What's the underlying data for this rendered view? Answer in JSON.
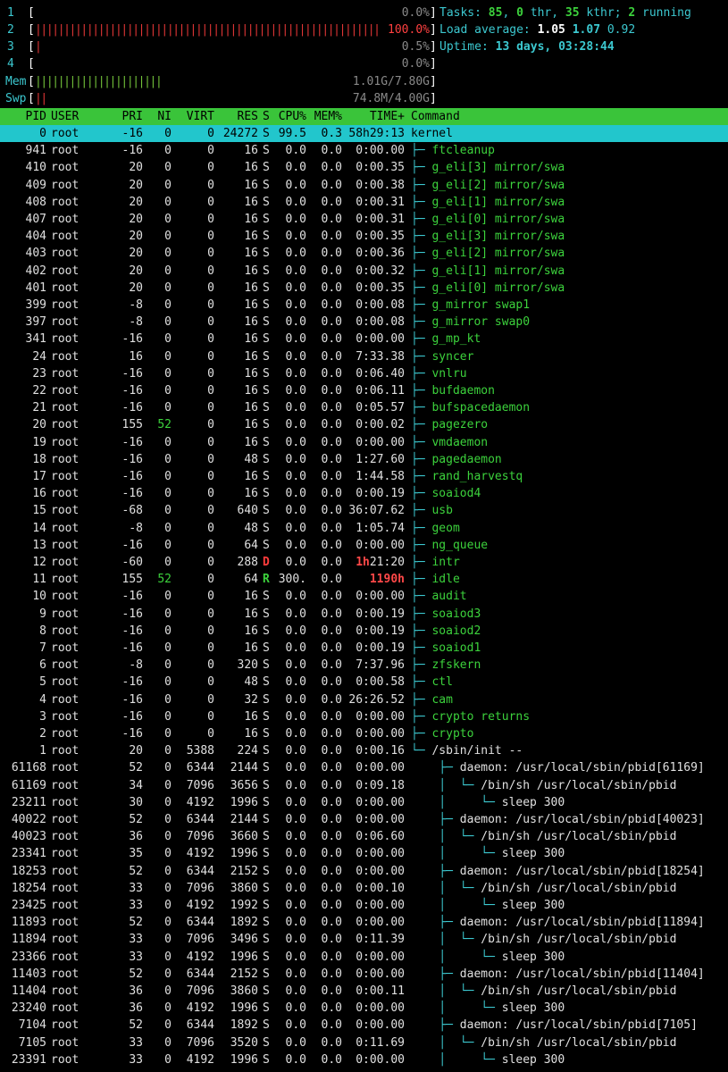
{
  "meters": {
    "cpu": [
      {
        "label": "1",
        "bar": "",
        "percent": "0.0%"
      },
      {
        "label": "2",
        "bar": "||||||||||||||||||||||||||||||||||||||||||||||||||||||||||||||||",
        "percent": "100.0%"
      },
      {
        "label": "3",
        "bar": "|",
        "percent": "0.5%"
      },
      {
        "label": "4",
        "bar": "",
        "percent": "0.0%"
      }
    ],
    "mem": {
      "label": "Mem",
      "bar": "||||||||||||||||||||||",
      "value": "1.01G/7.80G"
    },
    "swp": {
      "label": "Swp",
      "bar": "||",
      "value": "74.8M/4.00G"
    }
  },
  "summary": {
    "tasks_label": "Tasks: ",
    "tasks": "85",
    "thr": "0",
    "thr_label": " thr, ",
    "kthr": "35",
    "kthr_label": " kthr; ",
    "running": "2",
    "running_label": " running",
    "load_label": "Load average: ",
    "load1": "1.05",
    "load5": "1.07",
    "load15": "0.92",
    "uptime_label": "Uptime: ",
    "uptime": "13 days, 03:28:44"
  },
  "columns": [
    "PID",
    "USER",
    "PRI",
    "NI",
    "VIRT",
    "RES",
    "S",
    "CPU%",
    "MEM%",
    "TIME+",
    "Command"
  ],
  "processes": [
    {
      "pid": "0",
      "user": "root",
      "pri": "-16",
      "ni": "0",
      "virt": "0",
      "res": "24272",
      "s": "S",
      "cpu": "99.5",
      "mem": "0.3",
      "time": "58h29:13",
      "tree": "",
      "cmd": "kernel",
      "type": "sel"
    },
    {
      "pid": "941",
      "user": "root",
      "pri": "-16",
      "ni": "0",
      "virt": "0",
      "res": "16",
      "s": "S",
      "cpu": "0.0",
      "mem": "0.0",
      "time": "0:00.00",
      "tree": "├─ ",
      "cmd": "ftcleanup",
      "type": "k"
    },
    {
      "pid": "410",
      "user": "root",
      "pri": "20",
      "ni": "0",
      "virt": "0",
      "res": "16",
      "s": "S",
      "cpu": "0.0",
      "mem": "0.0",
      "time": "0:00.35",
      "tree": "├─ ",
      "cmd": "g_eli[3] mirror/swa",
      "type": "k"
    },
    {
      "pid": "409",
      "user": "root",
      "pri": "20",
      "ni": "0",
      "virt": "0",
      "res": "16",
      "s": "S",
      "cpu": "0.0",
      "mem": "0.0",
      "time": "0:00.38",
      "tree": "├─ ",
      "cmd": "g_eli[2] mirror/swa",
      "type": "k"
    },
    {
      "pid": "408",
      "user": "root",
      "pri": "20",
      "ni": "0",
      "virt": "0",
      "res": "16",
      "s": "S",
      "cpu": "0.0",
      "mem": "0.0",
      "time": "0:00.31",
      "tree": "├─ ",
      "cmd": "g_eli[1] mirror/swa",
      "type": "k"
    },
    {
      "pid": "407",
      "user": "root",
      "pri": "20",
      "ni": "0",
      "virt": "0",
      "res": "16",
      "s": "S",
      "cpu": "0.0",
      "mem": "0.0",
      "time": "0:00.31",
      "tree": "├─ ",
      "cmd": "g_eli[0] mirror/swa",
      "type": "k"
    },
    {
      "pid": "404",
      "user": "root",
      "pri": "20",
      "ni": "0",
      "virt": "0",
      "res": "16",
      "s": "S",
      "cpu": "0.0",
      "mem": "0.0",
      "time": "0:00.35",
      "tree": "├─ ",
      "cmd": "g_eli[3] mirror/swa",
      "type": "k"
    },
    {
      "pid": "403",
      "user": "root",
      "pri": "20",
      "ni": "0",
      "virt": "0",
      "res": "16",
      "s": "S",
      "cpu": "0.0",
      "mem": "0.0",
      "time": "0:00.36",
      "tree": "├─ ",
      "cmd": "g_eli[2] mirror/swa",
      "type": "k"
    },
    {
      "pid": "402",
      "user": "root",
      "pri": "20",
      "ni": "0",
      "virt": "0",
      "res": "16",
      "s": "S",
      "cpu": "0.0",
      "mem": "0.0",
      "time": "0:00.32",
      "tree": "├─ ",
      "cmd": "g_eli[1] mirror/swa",
      "type": "k"
    },
    {
      "pid": "401",
      "user": "root",
      "pri": "20",
      "ni": "0",
      "virt": "0",
      "res": "16",
      "s": "S",
      "cpu": "0.0",
      "mem": "0.0",
      "time": "0:00.35",
      "tree": "├─ ",
      "cmd": "g_eli[0] mirror/swa",
      "type": "k"
    },
    {
      "pid": "399",
      "user": "root",
      "pri": "-8",
      "ni": "0",
      "virt": "0",
      "res": "16",
      "s": "S",
      "cpu": "0.0",
      "mem": "0.0",
      "time": "0:00.08",
      "tree": "├─ ",
      "cmd": "g_mirror swap1",
      "type": "k"
    },
    {
      "pid": "397",
      "user": "root",
      "pri": "-8",
      "ni": "0",
      "virt": "0",
      "res": "16",
      "s": "S",
      "cpu": "0.0",
      "mem": "0.0",
      "time": "0:00.08",
      "tree": "├─ ",
      "cmd": "g_mirror swap0",
      "type": "k"
    },
    {
      "pid": "341",
      "user": "root",
      "pri": "-16",
      "ni": "0",
      "virt": "0",
      "res": "16",
      "s": "S",
      "cpu": "0.0",
      "mem": "0.0",
      "time": "0:00.00",
      "tree": "├─ ",
      "cmd": "g_mp_kt",
      "type": "k"
    },
    {
      "pid": "24",
      "user": "root",
      "pri": "16",
      "ni": "0",
      "virt": "0",
      "res": "16",
      "s": "S",
      "cpu": "0.0",
      "mem": "0.0",
      "time": "7:33.38",
      "tree": "├─ ",
      "cmd": "syncer",
      "type": "k"
    },
    {
      "pid": "23",
      "user": "root",
      "pri": "-16",
      "ni": "0",
      "virt": "0",
      "res": "16",
      "s": "S",
      "cpu": "0.0",
      "mem": "0.0",
      "time": "0:06.40",
      "tree": "├─ ",
      "cmd": "vnlru",
      "type": "k"
    },
    {
      "pid": "22",
      "user": "root",
      "pri": "-16",
      "ni": "0",
      "virt": "0",
      "res": "16",
      "s": "S",
      "cpu": "0.0",
      "mem": "0.0",
      "time": "0:06.11",
      "tree": "├─ ",
      "cmd": "bufdaemon",
      "type": "k"
    },
    {
      "pid": "21",
      "user": "root",
      "pri": "-16",
      "ni": "0",
      "virt": "0",
      "res": "16",
      "s": "S",
      "cpu": "0.0",
      "mem": "0.0",
      "time": "0:05.57",
      "tree": "├─ ",
      "cmd": "bufspacedaemon",
      "type": "k"
    },
    {
      "pid": "20",
      "user": "root",
      "pri": "155",
      "ni": "52",
      "virt": "0",
      "res": "16",
      "s": "S",
      "cpu": "0.0",
      "mem": "0.0",
      "time": "0:00.02",
      "tree": "├─ ",
      "cmd": "pagezero",
      "type": "k",
      "ni_green": true
    },
    {
      "pid": "19",
      "user": "root",
      "pri": "-16",
      "ni": "0",
      "virt": "0",
      "res": "16",
      "s": "S",
      "cpu": "0.0",
      "mem": "0.0",
      "time": "0:00.00",
      "tree": "├─ ",
      "cmd": "vmdaemon",
      "type": "k"
    },
    {
      "pid": "18",
      "user": "root",
      "pri": "-16",
      "ni": "0",
      "virt": "0",
      "res": "48",
      "s": "S",
      "cpu": "0.0",
      "mem": "0.0",
      "time": "1:27.60",
      "tree": "├─ ",
      "cmd": "pagedaemon",
      "type": "k"
    },
    {
      "pid": "17",
      "user": "root",
      "pri": "-16",
      "ni": "0",
      "virt": "0",
      "res": "16",
      "s": "S",
      "cpu": "0.0",
      "mem": "0.0",
      "time": "1:44.58",
      "tree": "├─ ",
      "cmd": "rand_harvestq",
      "type": "k"
    },
    {
      "pid": "16",
      "user": "root",
      "pri": "-16",
      "ni": "0",
      "virt": "0",
      "res": "16",
      "s": "S",
      "cpu": "0.0",
      "mem": "0.0",
      "time": "0:00.19",
      "tree": "├─ ",
      "cmd": "soaiod4",
      "type": "k"
    },
    {
      "pid": "15",
      "user": "root",
      "pri": "-68",
      "ni": "0",
      "virt": "0",
      "res": "640",
      "s": "S",
      "cpu": "0.0",
      "mem": "0.0",
      "time": "36:07.62",
      "tree": "├─ ",
      "cmd": "usb",
      "type": "k"
    },
    {
      "pid": "14",
      "user": "root",
      "pri": "-8",
      "ni": "0",
      "virt": "0",
      "res": "48",
      "s": "S",
      "cpu": "0.0",
      "mem": "0.0",
      "time": "1:05.74",
      "tree": "├─ ",
      "cmd": "geom",
      "type": "k"
    },
    {
      "pid": "13",
      "user": "root",
      "pri": "-16",
      "ni": "0",
      "virt": "0",
      "res": "64",
      "s": "S",
      "cpu": "0.0",
      "mem": "0.0",
      "time": "0:00.00",
      "tree": "├─ ",
      "cmd": "ng_queue",
      "type": "k"
    },
    {
      "pid": "12",
      "user": "root",
      "pri": "-60",
      "ni": "0",
      "virt": "0",
      "res": "288",
      "s": "D",
      "cpu": "0.0",
      "mem": "0.0",
      "time": "1h21:20",
      "time_hi": "1h",
      "time_rest": "21:20",
      "tree": "├─ ",
      "cmd": "intr",
      "type": "k"
    },
    {
      "pid": "11",
      "user": "root",
      "pri": "155",
      "ni": "52",
      "virt": "0",
      "res": "64",
      "s": "R",
      "cpu": "300.",
      "mem": "0.0",
      "time": "1190h",
      "time_hi": "1190h",
      "time_rest": "",
      "tree": "├─ ",
      "cmd": "idle",
      "type": "k",
      "ni_green": true
    },
    {
      "pid": "10",
      "user": "root",
      "pri": "-16",
      "ni": "0",
      "virt": "0",
      "res": "16",
      "s": "S",
      "cpu": "0.0",
      "mem": "0.0",
      "time": "0:00.00",
      "tree": "├─ ",
      "cmd": "audit",
      "type": "k"
    },
    {
      "pid": "9",
      "user": "root",
      "pri": "-16",
      "ni": "0",
      "virt": "0",
      "res": "16",
      "s": "S",
      "cpu": "0.0",
      "mem": "0.0",
      "time": "0:00.19",
      "tree": "├─ ",
      "cmd": "soaiod3",
      "type": "k"
    },
    {
      "pid": "8",
      "user": "root",
      "pri": "-16",
      "ni": "0",
      "virt": "0",
      "res": "16",
      "s": "S",
      "cpu": "0.0",
      "mem": "0.0",
      "time": "0:00.19",
      "tree": "├─ ",
      "cmd": "soaiod2",
      "type": "k"
    },
    {
      "pid": "7",
      "user": "root",
      "pri": "-16",
      "ni": "0",
      "virt": "0",
      "res": "16",
      "s": "S",
      "cpu": "0.0",
      "mem": "0.0",
      "time": "0:00.19",
      "tree": "├─ ",
      "cmd": "soaiod1",
      "type": "k"
    },
    {
      "pid": "6",
      "user": "root",
      "pri": "-8",
      "ni": "0",
      "virt": "0",
      "res": "320",
      "s": "S",
      "cpu": "0.0",
      "mem": "0.0",
      "time": "7:37.96",
      "tree": "├─ ",
      "cmd": "zfskern",
      "type": "k"
    },
    {
      "pid": "5",
      "user": "root",
      "pri": "-16",
      "ni": "0",
      "virt": "0",
      "res": "48",
      "s": "S",
      "cpu": "0.0",
      "mem": "0.0",
      "time": "0:00.58",
      "tree": "├─ ",
      "cmd": "ctl",
      "type": "k"
    },
    {
      "pid": "4",
      "user": "root",
      "pri": "-16",
      "ni": "0",
      "virt": "0",
      "res": "32",
      "s": "S",
      "cpu": "0.0",
      "mem": "0.0",
      "time": "26:26.52",
      "tree": "├─ ",
      "cmd": "cam",
      "type": "k"
    },
    {
      "pid": "3",
      "user": "root",
      "pri": "-16",
      "ni": "0",
      "virt": "0",
      "res": "16",
      "s": "S",
      "cpu": "0.0",
      "mem": "0.0",
      "time": "0:00.00",
      "tree": "├─ ",
      "cmd": "crypto returns",
      "type": "k"
    },
    {
      "pid": "2",
      "user": "root",
      "pri": "-16",
      "ni": "0",
      "virt": "0",
      "res": "16",
      "s": "S",
      "cpu": "0.0",
      "mem": "0.0",
      "time": "0:00.00",
      "tree": "├─ ",
      "cmd": "crypto",
      "type": "k"
    },
    {
      "pid": "1",
      "user": "root",
      "pri": "20",
      "ni": "0",
      "virt": "5388",
      "res": "224",
      "s": "S",
      "cpu": "0.0",
      "mem": "0.0",
      "time": "0:00.16",
      "tree": "└─ ",
      "cmd": "/sbin/init --",
      "type": "u"
    },
    {
      "pid": "61168",
      "user": "root",
      "pri": "52",
      "ni": "0",
      "virt": "6344",
      "res": "2144",
      "s": "S",
      "cpu": "0.0",
      "mem": "0.0",
      "time": "0:00.00",
      "tree": "    ├─ ",
      "cmd": "daemon: /usr/local/sbin/pbid[61169]",
      "type": "u"
    },
    {
      "pid": "61169",
      "user": "root",
      "pri": "34",
      "ni": "0",
      "virt": "7096",
      "res": "3656",
      "s": "S",
      "cpu": "0.0",
      "mem": "0.0",
      "time": "0:09.18",
      "tree": "    │  └─ ",
      "cmd": "/bin/sh /usr/local/sbin/pbid",
      "type": "u"
    },
    {
      "pid": "23211",
      "user": "root",
      "pri": "30",
      "ni": "0",
      "virt": "4192",
      "res": "1996",
      "s": "S",
      "cpu": "0.0",
      "mem": "0.0",
      "time": "0:00.00",
      "tree": "    │     └─ ",
      "cmd": "sleep 300",
      "type": "u"
    },
    {
      "pid": "40022",
      "user": "root",
      "pri": "52",
      "ni": "0",
      "virt": "6344",
      "res": "2144",
      "s": "S",
      "cpu": "0.0",
      "mem": "0.0",
      "time": "0:00.00",
      "tree": "    ├─ ",
      "cmd": "daemon: /usr/local/sbin/pbid[40023]",
      "type": "u"
    },
    {
      "pid": "40023",
      "user": "root",
      "pri": "36",
      "ni": "0",
      "virt": "7096",
      "res": "3660",
      "s": "S",
      "cpu": "0.0",
      "mem": "0.0",
      "time": "0:06.60",
      "tree": "    │  └─ ",
      "cmd": "/bin/sh /usr/local/sbin/pbid",
      "type": "u"
    },
    {
      "pid": "23341",
      "user": "root",
      "pri": "35",
      "ni": "0",
      "virt": "4192",
      "res": "1996",
      "s": "S",
      "cpu": "0.0",
      "mem": "0.0",
      "time": "0:00.00",
      "tree": "    │     └─ ",
      "cmd": "sleep 300",
      "type": "u"
    },
    {
      "pid": "18253",
      "user": "root",
      "pri": "52",
      "ni": "0",
      "virt": "6344",
      "res": "2152",
      "s": "S",
      "cpu": "0.0",
      "mem": "0.0",
      "time": "0:00.00",
      "tree": "    ├─ ",
      "cmd": "daemon: /usr/local/sbin/pbid[18254]",
      "type": "u"
    },
    {
      "pid": "18254",
      "user": "root",
      "pri": "33",
      "ni": "0",
      "virt": "7096",
      "res": "3860",
      "s": "S",
      "cpu": "0.0",
      "mem": "0.0",
      "time": "0:00.10",
      "tree": "    │  └─ ",
      "cmd": "/bin/sh /usr/local/sbin/pbid",
      "type": "u"
    },
    {
      "pid": "23425",
      "user": "root",
      "pri": "33",
      "ni": "0",
      "virt": "4192",
      "res": "1992",
      "s": "S",
      "cpu": "0.0",
      "mem": "0.0",
      "time": "0:00.00",
      "tree": "    │     └─ ",
      "cmd": "sleep 300",
      "type": "u"
    },
    {
      "pid": "11893",
      "user": "root",
      "pri": "52",
      "ni": "0",
      "virt": "6344",
      "res": "1892",
      "s": "S",
      "cpu": "0.0",
      "mem": "0.0",
      "time": "0:00.00",
      "tree": "    ├─ ",
      "cmd": "daemon: /usr/local/sbin/pbid[11894]",
      "type": "u"
    },
    {
      "pid": "11894",
      "user": "root",
      "pri": "33",
      "ni": "0",
      "virt": "7096",
      "res": "3496",
      "s": "S",
      "cpu": "0.0",
      "mem": "0.0",
      "time": "0:11.39",
      "tree": "    │  └─ ",
      "cmd": "/bin/sh /usr/local/sbin/pbid",
      "type": "u"
    },
    {
      "pid": "23366",
      "user": "root",
      "pri": "33",
      "ni": "0",
      "virt": "4192",
      "res": "1996",
      "s": "S",
      "cpu": "0.0",
      "mem": "0.0",
      "time": "0:00.00",
      "tree": "    │     └─ ",
      "cmd": "sleep 300",
      "type": "u"
    },
    {
      "pid": "11403",
      "user": "root",
      "pri": "52",
      "ni": "0",
      "virt": "6344",
      "res": "2152",
      "s": "S",
      "cpu": "0.0",
      "mem": "0.0",
      "time": "0:00.00",
      "tree": "    ├─ ",
      "cmd": "daemon: /usr/local/sbin/pbid[11404]",
      "type": "u"
    },
    {
      "pid": "11404",
      "user": "root",
      "pri": "36",
      "ni": "0",
      "virt": "7096",
      "res": "3860",
      "s": "S",
      "cpu": "0.0",
      "mem": "0.0",
      "time": "0:00.11",
      "tree": "    │  └─ ",
      "cmd": "/bin/sh /usr/local/sbin/pbid",
      "type": "u"
    },
    {
      "pid": "23240",
      "user": "root",
      "pri": "36",
      "ni": "0",
      "virt": "4192",
      "res": "1996",
      "s": "S",
      "cpu": "0.0",
      "mem": "0.0",
      "time": "0:00.00",
      "tree": "    │     └─ ",
      "cmd": "sleep 300",
      "type": "u"
    },
    {
      "pid": "7104",
      "user": "root",
      "pri": "52",
      "ni": "0",
      "virt": "6344",
      "res": "1892",
      "s": "S",
      "cpu": "0.0",
      "mem": "0.0",
      "time": "0:00.00",
      "tree": "    ├─ ",
      "cmd": "daemon: /usr/local/sbin/pbid[7105]",
      "type": "u"
    },
    {
      "pid": "7105",
      "user": "root",
      "pri": "33",
      "ni": "0",
      "virt": "7096",
      "res": "3520",
      "s": "S",
      "cpu": "0.0",
      "mem": "0.0",
      "time": "0:11.69",
      "tree": "    │  └─ ",
      "cmd": "/bin/sh /usr/local/sbin/pbid",
      "type": "u"
    },
    {
      "pid": "23391",
      "user": "root",
      "pri": "33",
      "ni": "0",
      "virt": "4192",
      "res": "1996",
      "s": "S",
      "cpu": "0.0",
      "mem": "0.0",
      "time": "0:00.00",
      "tree": "    │     └─ ",
      "cmd": "sleep 300",
      "type": "u"
    }
  ]
}
